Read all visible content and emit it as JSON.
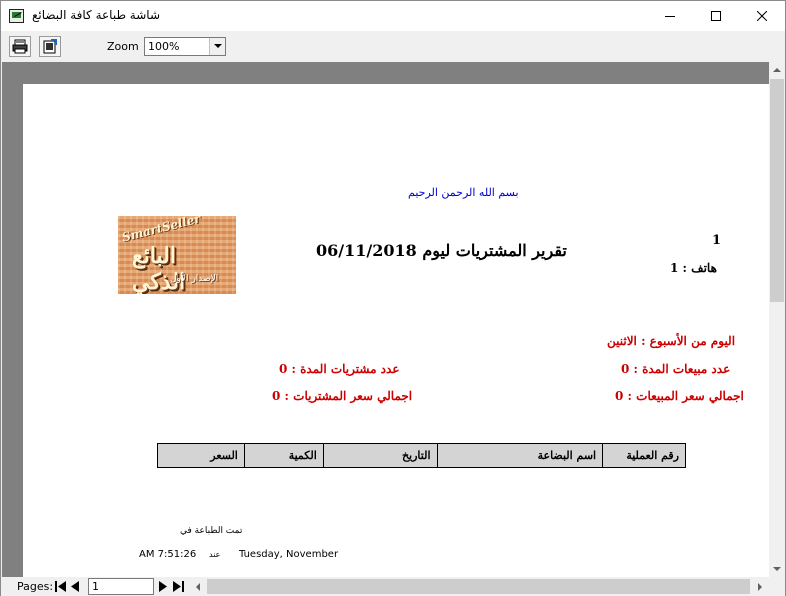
{
  "window": {
    "title": "شاشة طباعة كافة البضائع",
    "icon": "report-app-icon"
  },
  "toolbar": {
    "print_icon": "printer-icon",
    "export_icon": "export-icon",
    "zoom_label": "Zoom",
    "zoom_value": "100%"
  },
  "report": {
    "basmala": "بسم الله الرحمن الرحيم",
    "logo": {
      "brand_en": "SmartSeller",
      "brand_ar": "البائع الذكي",
      "tagline": "الإصدار الأول"
    },
    "title": "تقرير المشتريات ليوم 06/11/2018",
    "id": "1",
    "phone": "هاتف : 1",
    "day_of_week": "اليوم من الأسبوع : الاثنين",
    "sales_count": "عدد مبيعات المدة : 0",
    "purchases_count": "عدد مشتريات المدة : 0",
    "sales_total": "اجمالي سعر المبيعات : 0",
    "purchases_total": "اجمالي سعر المشتريات : 0",
    "table_headers": [
      "رقم العملية",
      "اسم البضاعة",
      "التاريخ",
      "الكمية",
      "السعر"
    ],
    "printed_at_label": "تمت الطباعة في",
    "print_date": "Tuesday, November",
    "print_sep": "عند",
    "print_time": "AM 7:51:26"
  },
  "statusbar": {
    "pages_label": "Pages:",
    "page_value": "1"
  },
  "colors": {
    "basmala": "#0000cc",
    "stats": "#cc0000",
    "preview_bg": "#808080",
    "table_header_bg": "#d4d4d4"
  }
}
